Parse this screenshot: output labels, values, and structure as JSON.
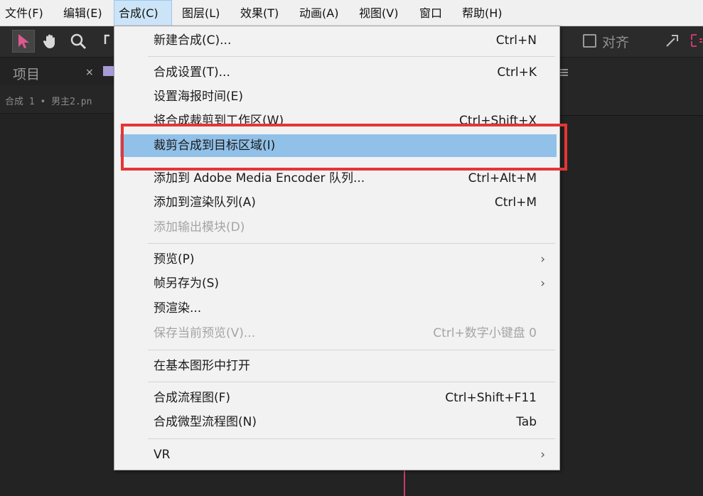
{
  "menubar": {
    "items": [
      {
        "label": "文件(F)",
        "active": false
      },
      {
        "label": "编辑(E)",
        "active": false
      },
      {
        "label": "合成(C)",
        "active": true
      },
      {
        "label": "图层(L)",
        "active": false
      },
      {
        "label": "效果(T)",
        "active": false
      },
      {
        "label": "动画(A)",
        "active": false
      },
      {
        "label": "视图(V)",
        "active": false
      },
      {
        "label": "窗口",
        "active": false
      },
      {
        "label": "帮助(H)",
        "active": false
      }
    ]
  },
  "toolbar": {
    "align_label": "对齐"
  },
  "project_panel": {
    "tab_label": "项目",
    "close_glyph": "×",
    "breadcrumb": "合成 1 • 男主2.pn"
  },
  "menu": {
    "items": [
      {
        "label": "新建合成(C)...",
        "shortcut": "Ctrl+N"
      },
      {
        "separator": true
      },
      {
        "label": "合成设置(T)...",
        "shortcut": "Ctrl+K"
      },
      {
        "label": "设置海报时间(E)",
        "shortcut": ""
      },
      {
        "label": "将合成裁剪到工作区(W)",
        "shortcut": "Ctrl+Shift+X"
      },
      {
        "label": "裁剪合成到目标区域(I)",
        "shortcut": "",
        "highlighted": true
      },
      {
        "label": "添加到 Adobe Media Encoder 队列...",
        "shortcut": "Ctrl+Alt+M"
      },
      {
        "label": "添加到渲染队列(A)",
        "shortcut": "Ctrl+M"
      },
      {
        "label": "添加输出模块(D)",
        "shortcut": "",
        "disabled": true
      },
      {
        "separator": true
      },
      {
        "label": "预览(P)",
        "shortcut": "",
        "submenu": true
      },
      {
        "label": "帧另存为(S)",
        "shortcut": "",
        "submenu": true
      },
      {
        "label": "预渲染...",
        "shortcut": ""
      },
      {
        "label": "保存当前预览(V)...",
        "shortcut": "Ctrl+数字小键盘 0",
        "disabled": true
      },
      {
        "separator": true
      },
      {
        "label": "在基本图形中打开",
        "shortcut": ""
      },
      {
        "separator": true
      },
      {
        "label": "合成流程图(F)",
        "shortcut": "Ctrl+Shift+F11"
      },
      {
        "label": "合成微型流程图(N)",
        "shortcut": "Tab"
      },
      {
        "separator": true
      },
      {
        "label": "VR",
        "shortcut": "",
        "submenu": true
      }
    ],
    "submenu_glyph": "›"
  },
  "colors": {
    "highlight": "#91c1e8",
    "annotation": "#e63535",
    "accent_pink": "#c83a6e"
  },
  "icons": [
    "selection-tool-icon",
    "hand-tool-icon",
    "zoom-tool-icon",
    "rotate-tool-icon",
    "hamburger-menu-icon",
    "snap-icon"
  ]
}
